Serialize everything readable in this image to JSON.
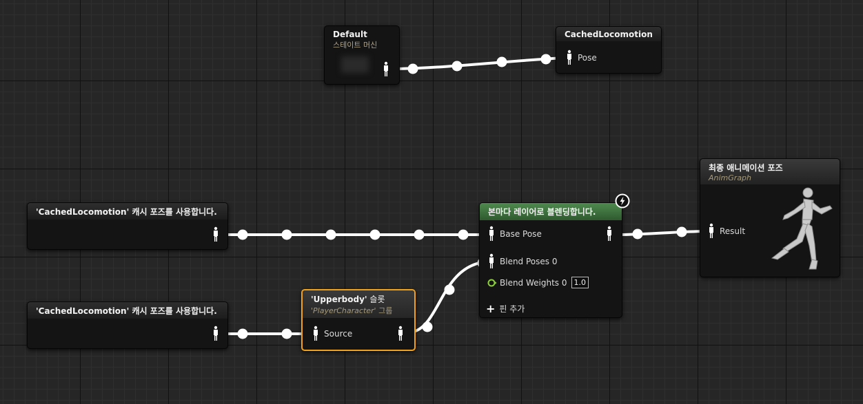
{
  "colors": {
    "wire": "#ffffff",
    "blend_header": "#3e6b3e",
    "selection": "#f2a11c",
    "float_pin": "#8cd13b"
  },
  "nodes": {
    "default_state": {
      "title": "Default",
      "subtitle": "스테이트 머신",
      "icon": "pose-pin-icon"
    },
    "cached_locomotion_save": {
      "title": "CachedLocomotion",
      "pin": "Pose"
    },
    "use_cached_1": {
      "title": "'CachedLocomotion' 캐시 포즈를 사용합니다."
    },
    "use_cached_2": {
      "title": "'CachedLocomotion' 캐시 포즈를 사용합니다."
    },
    "slot": {
      "title_name": "'Upperbody'",
      "title_suffix": " 슬롯",
      "subtitle_name": "'PlayerCharacter'",
      "subtitle_suffix": " 그룹",
      "pin": "Source"
    },
    "blend": {
      "title": "본마다 레이어로 블렌딩합니다.",
      "pins": {
        "base": "Base Pose",
        "blend_poses": "Blend Poses 0",
        "blend_weights": "Blend Weights 0",
        "weight_value": "1.0",
        "add_pin": "핀 추가"
      },
      "badge_icon": "lightning-icon"
    },
    "final": {
      "title": "최종 애니메이션 포즈",
      "subtitle": "AnimGraph",
      "pin": "Result",
      "preview": "running-mannequin-icon"
    }
  }
}
